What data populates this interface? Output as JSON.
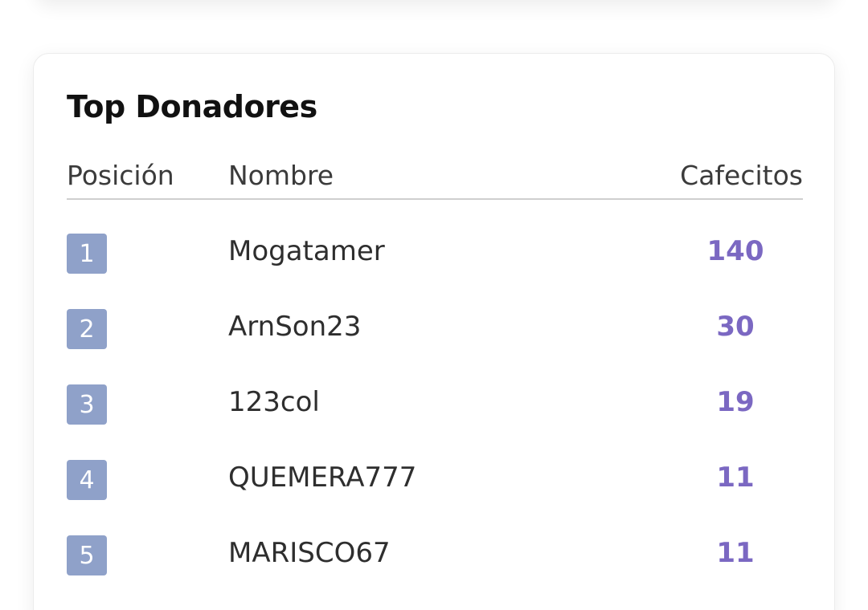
{
  "card": {
    "title": "Top Donadores"
  },
  "table": {
    "headers": {
      "position": "Posición",
      "name": "Nombre",
      "coffees": "Cafecitos"
    },
    "rows": [
      {
        "position": "1",
        "name": "Mogatamer",
        "coffees": "140"
      },
      {
        "position": "2",
        "name": "ArnSon23",
        "coffees": "30"
      },
      {
        "position": "3",
        "name": "123col",
        "coffees": "19"
      },
      {
        "position": "4",
        "name": "QUEMERA777",
        "coffees": "11"
      },
      {
        "position": "5",
        "name": "MARISCO67",
        "coffees": "11"
      }
    ]
  },
  "colors": {
    "badge": "#8fa1c9",
    "count": "#7b68c2"
  }
}
